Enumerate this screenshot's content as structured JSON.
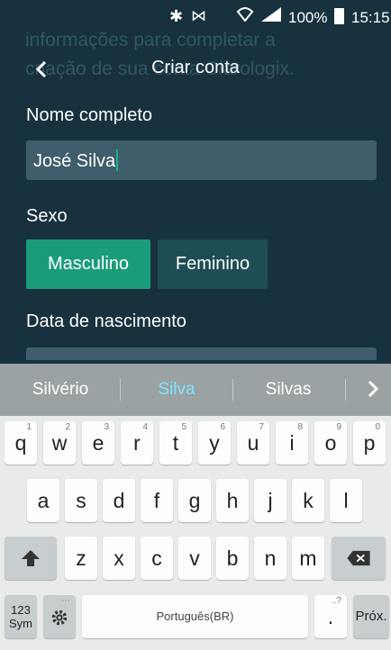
{
  "status_bar": {
    "battery": "100%",
    "time": "15:15"
  },
  "background_text": {
    "line1": "informações para completar a",
    "line2": "criação de sua conta Clarologix."
  },
  "header": {
    "title": "Criar conta"
  },
  "form": {
    "name_label": "Nome completo",
    "name_value": "José Silva",
    "sex_label": "Sexo",
    "sex_options": [
      "Masculino",
      "Feminino"
    ],
    "sex_selected": "Masculino",
    "dob_label": "Data de nascimento"
  },
  "keyboard": {
    "suggestions": [
      "Silvério",
      "Silva",
      "Silvas"
    ],
    "row1": [
      "q",
      "w",
      "e",
      "r",
      "t",
      "y",
      "u",
      "i",
      "o",
      "p"
    ],
    "row1_numbers": [
      "1",
      "2",
      "3",
      "4",
      "5",
      "6",
      "7",
      "8",
      "9",
      "0"
    ],
    "row2": [
      "a",
      "s",
      "d",
      "f",
      "g",
      "h",
      "j",
      "k",
      "l"
    ],
    "row3": [
      "z",
      "x",
      "c",
      "v",
      "b",
      "n",
      "m"
    ],
    "sym_label_top": "123",
    "sym_label_bottom": "Sym",
    "language": "Português(BR)",
    "period": ".",
    "period_hint": "..?",
    "next_label": "Próx."
  },
  "colors": {
    "accent": "#1a9c7a",
    "background": "#17323e",
    "suggestion_highlight": "#7fe4ff"
  }
}
